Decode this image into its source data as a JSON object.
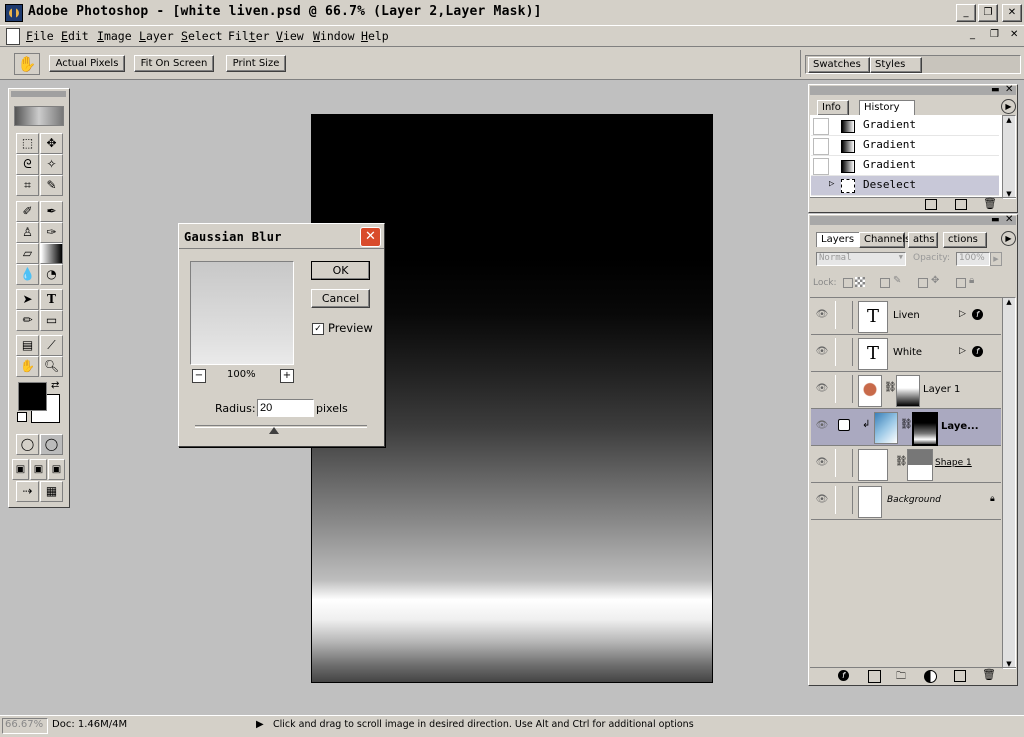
{
  "window": {
    "title": "Adobe Photoshop - [white liven.psd @ 66.7% (Layer 2,Layer Mask)]",
    "controls": {
      "minimize": "_",
      "maximize": "❐",
      "close": "✕"
    }
  },
  "menu": [
    {
      "label": "File",
      "key": "F"
    },
    {
      "label": "Edit",
      "key": "E"
    },
    {
      "label": "Image",
      "key": "I"
    },
    {
      "label": "Layer",
      "key": "L"
    },
    {
      "label": "Select",
      "key": "S"
    },
    {
      "label": "Filter",
      "key": "t"
    },
    {
      "label": "View",
      "key": "V"
    },
    {
      "label": "Window",
      "key": "W"
    },
    {
      "label": "Help",
      "key": "H"
    }
  ],
  "options_bar": {
    "actual_pixels": "Actual Pixels",
    "fit_on_screen": "Fit On Screen",
    "print_size": "Print Size"
  },
  "palette_well": {
    "swatches": "Swatches",
    "styles": "Styles"
  },
  "dialog": {
    "title": "Gaussian Blur",
    "ok": "OK",
    "cancel": "Cancel",
    "preview_label": "Preview",
    "preview_checked": true,
    "zoom": "100%",
    "zoom_minus": "−",
    "zoom_plus": "+",
    "radius_label": "Radius:",
    "radius_value": "20",
    "radius_unit": "pixels"
  },
  "history_palette": {
    "tabs": [
      "Info",
      "History"
    ],
    "items": [
      "Gradient",
      "Gradient",
      "Gradient",
      "Deselect"
    ],
    "selected_index": 3
  },
  "layers_palette": {
    "tabs": [
      "Layers",
      "Channels",
      "Paths",
      "Actions"
    ],
    "tabs_visible": [
      "Layers",
      "Channels",
      "aths",
      "ctions"
    ],
    "blend_mode": "Normal",
    "opacity_label": "Opacity:",
    "opacity_value": "100%",
    "lock_label": "Lock:",
    "layers": [
      {
        "name": "Liven",
        "type": "text"
      },
      {
        "name": "White",
        "type": "text"
      },
      {
        "name": "Layer 1",
        "type": "image"
      },
      {
        "name": "Laye...",
        "type": "image",
        "selected": true
      },
      {
        "name": "Shape 1",
        "type": "shape"
      },
      {
        "name": "Background",
        "type": "background"
      }
    ]
  },
  "status_bar": {
    "zoom": "66.67%",
    "doc": "Doc: 1.46M/4M",
    "hint": "Click and drag to scroll image in desired direction.  Use Alt and Ctrl for additional options"
  }
}
